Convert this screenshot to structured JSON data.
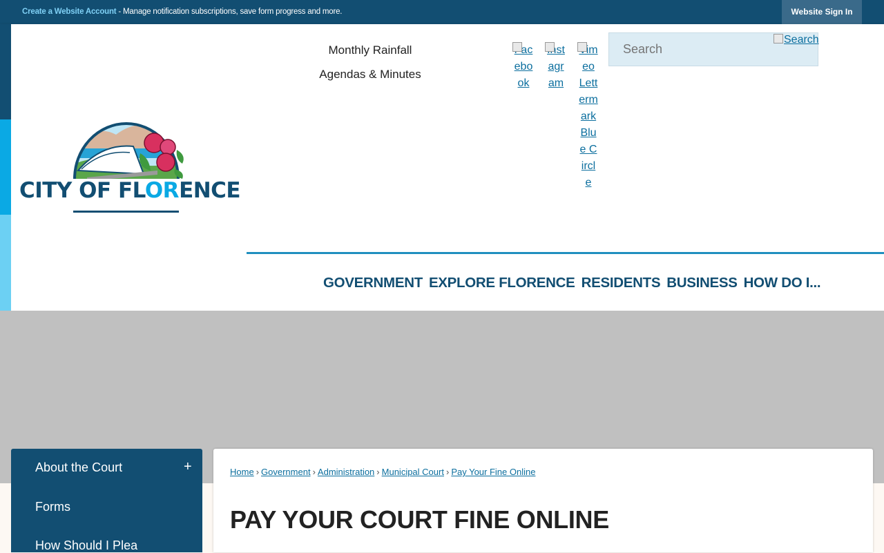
{
  "topbar": {
    "account_link": "Create a Website Account",
    "account_desc": " - Manage notification subscriptions, save form progress and more.",
    "signin_label": "Website Sign In"
  },
  "header": {
    "logo_text_pre": "CITY OF FL",
    "logo_text_hl": "OR",
    "logo_text_post": "ENCE",
    "quick_links": [
      "Monthly Rainfall",
      "Agendas & Minutes"
    ],
    "social": [
      {
        "alt": "Facebook",
        "icon": "facebook-icon"
      },
      {
        "alt": "Instagram",
        "icon": "instagram-icon"
      },
      {
        "alt": "Vimeo Lettermark Blue Circle",
        "icon": "vimeo-icon"
      }
    ],
    "search_placeholder": "Search",
    "search_button_alt": "Search"
  },
  "nav": {
    "items": [
      "GOVERNMENT",
      "EXPLORE FLORENCE",
      "RESIDENTS",
      "BUSINESS",
      "HOW DO I..."
    ]
  },
  "sidebar": {
    "items": [
      "About the Court",
      "Forms",
      "How Should I Plea"
    ],
    "expand_symbol": "+"
  },
  "breadcrumb": [
    "Home",
    "Government",
    "Administration",
    "Municipal Court",
    "Pay Your Fine Online"
  ],
  "page": {
    "title": "PAY YOUR COURT FINE ONLINE"
  },
  "colors": {
    "brand_dark": "#124e72",
    "brand_accent": "#0aa9e4",
    "brand_light": "#6cd0f3",
    "link": "#0b6e9e",
    "peony": "#d8305f"
  }
}
